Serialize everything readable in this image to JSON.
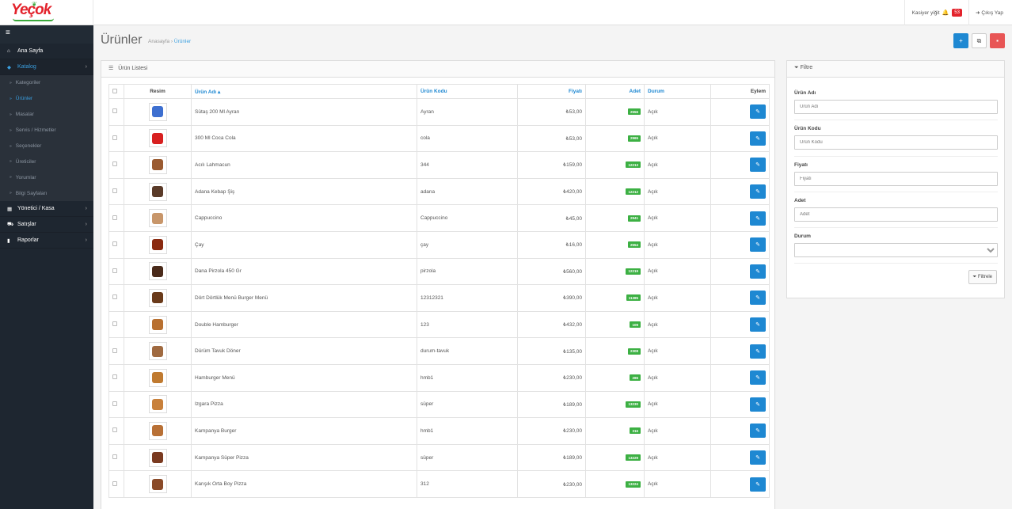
{
  "header": {
    "logo_text": "Yeçok",
    "cashier": "Kasiyer yiğit",
    "notifications": "53",
    "logout": "Çıkış Yap"
  },
  "sidebar": {
    "items": [
      {
        "label": "Ana Sayfa",
        "icon": "home-icon"
      },
      {
        "label": "Katalog",
        "icon": "tag-icon"
      },
      {
        "label": "Yönetici / Kasa",
        "icon": "cashbox-icon"
      },
      {
        "label": "Satışlar",
        "icon": "cart-icon"
      },
      {
        "label": "Raporlar",
        "icon": "chart-icon"
      }
    ],
    "sub_items": [
      "Kategoriler",
      "Ürünler",
      "Masalar",
      "Servis / Hizmetler",
      "Seçenekler",
      "Üreticiler",
      "Yorumlar",
      "Bilgi Sayfaları"
    ]
  },
  "page": {
    "title": "Ürünler",
    "breadcrumb_home": "Anasayfa",
    "breadcrumb_sep": "›",
    "breadcrumb_current": "Ürünler"
  },
  "list": {
    "panel_title": "Ürün Listesi",
    "columns": {
      "image": "Resim",
      "name": "Ürün Adı",
      "code": "Ürün Kodu",
      "price": "Fiyatı",
      "qty": "Adet",
      "status": "Durum",
      "action": "Eylem"
    },
    "rows": [
      {
        "name": "Sütaş 200 Ml Ayran",
        "code": "Ayran",
        "price": "₺53,00",
        "qty": "2556",
        "status": "Açık",
        "thumb_color": "#3d6fd0"
      },
      {
        "name": "300 Ml Coca Cola",
        "code": "cola",
        "price": "₺53,00",
        "qty": "2965",
        "status": "Açık",
        "thumb_color": "#d82020"
      },
      {
        "name": "Acılı Lahmacun",
        "code": "344",
        "price": "₺159,00",
        "qty": "12213",
        "status": "Açık",
        "thumb_color": "#9a5a30"
      },
      {
        "name": "Adana Kebap Şiş",
        "code": "adana",
        "price": "₺420,00",
        "qty": "12212",
        "status": "Açık",
        "thumb_color": "#5a3a28"
      },
      {
        "name": "Cappuccino",
        "code": "Cappuccino",
        "price": "₺45,00",
        "qty": "2941",
        "status": "Açık",
        "thumb_color": "#c8966a"
      },
      {
        "name": "Çay",
        "code": "çay",
        "price": "₺16,00",
        "qty": "2554",
        "status": "Açık",
        "thumb_color": "#8a2a10"
      },
      {
        "name": "Dana Pirzola 450 Gr",
        "code": "pirzola",
        "price": "₺560,00",
        "qty": "12219",
        "status": "Açık",
        "thumb_color": "#4a2a1a"
      },
      {
        "name": "Dört Dörtlük Menü Burger Menü",
        "code": "12312321",
        "price": "₺390,00",
        "qty": "11385",
        "status": "Açık",
        "thumb_color": "#6a3a1a"
      },
      {
        "name": "Double Hamburger",
        "code": "123",
        "price": "₺432,00",
        "qty": "109",
        "status": "Açık",
        "thumb_color": "#b87030"
      },
      {
        "name": "Dürüm Tavuk Döner",
        "code": "durum-tavuk",
        "price": "₺135,00",
        "qty": "2308",
        "status": "Açık",
        "thumb_color": "#a06a40"
      },
      {
        "name": "Hamburger Menü",
        "code": "hmb1",
        "price": "₺230,00",
        "qty": "286",
        "status": "Açık",
        "thumb_color": "#c07a30"
      },
      {
        "name": "Izgara Pizza",
        "code": "süper",
        "price": "₺189,00",
        "qty": "13230",
        "status": "Açık",
        "thumb_color": "#c8803a"
      },
      {
        "name": "Kampanya Burger",
        "code": "hmb1",
        "price": "₺230,00",
        "qty": "316",
        "status": "Açık",
        "thumb_color": "#b87035"
      },
      {
        "name": "Kampanya Süper Pizza",
        "code": "süper",
        "price": "₺189,00",
        "qty": "13229",
        "status": "Açık",
        "thumb_color": "#7a3a20"
      },
      {
        "name": "Karışık Orta Boy Pizza",
        "code": "312",
        "price": "₺230,00",
        "qty": "13224",
        "status": "Açık",
        "thumb_color": "#8a4a28"
      }
    ]
  },
  "filter": {
    "title": "Filtre",
    "fields": {
      "name_label": "Ürün Adı",
      "name_placeholder": "Ürün Adı",
      "code_label": "Ürün Kodu",
      "code_placeholder": "Ürün Kodu",
      "price_label": "Fiyatı",
      "price_placeholder": "Fiyatı",
      "qty_label": "Adet",
      "qty_placeholder": "Adet",
      "status_label": "Durum",
      "status_value": ""
    },
    "button": "Filtrele"
  },
  "colors": {
    "primary": "#1e88d2",
    "danger": "#e85555",
    "success": "#3cb043",
    "sidebar_bg": "#1e2630",
    "brand_red": "#e3232c"
  }
}
